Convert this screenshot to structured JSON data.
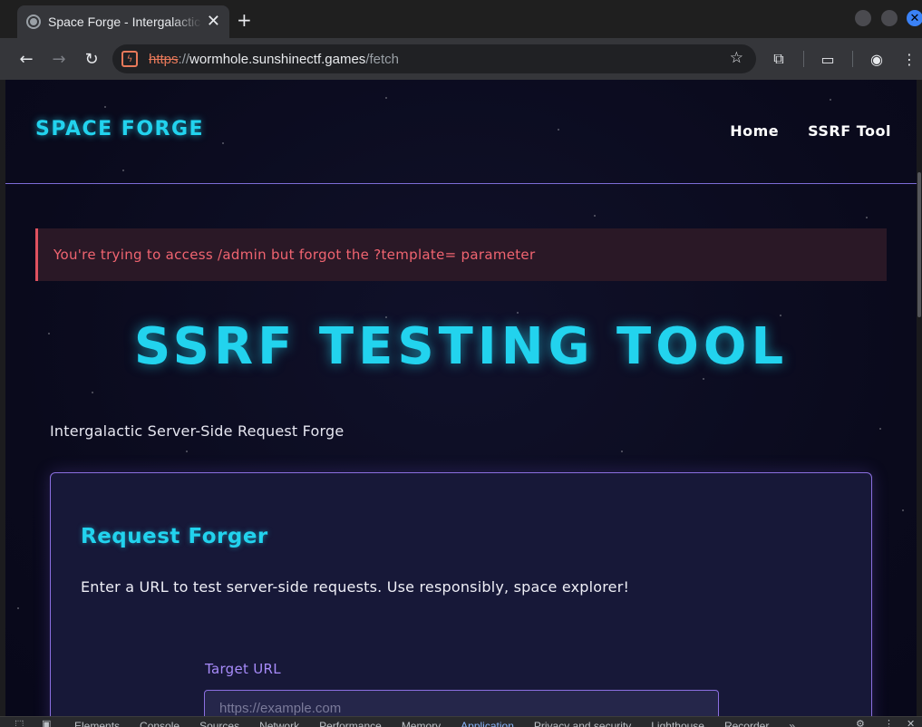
{
  "browser": {
    "tab_title": "Space Forge - Intergalactic",
    "tab_close": "✕",
    "new_tab": "+",
    "url_scheme": "https",
    "url_sep": "://",
    "url_host": "wormhole.sunshinectf.games",
    "url_path": "/fetch"
  },
  "site": {
    "logo": "SPACE FORGE",
    "nav": [
      "Home",
      "SSRF Tool"
    ]
  },
  "alert": {
    "message": "You're trying to access /admin but forgot the ?template= parameter",
    "color": "#e05260"
  },
  "hero": {
    "title": "SSRF TESTING TOOL",
    "subtitle": "Intergalactic Server-Side Request Forge"
  },
  "card": {
    "title": "Request Forger",
    "description": "Enter a URL to test server-side requests. Use responsibly, space explorer!",
    "field_label": "Target URL",
    "input_placeholder": "https://example.com",
    "input_value": ""
  },
  "devtools": {
    "tabs": [
      "Elements",
      "Console",
      "Sources",
      "Network",
      "Performance",
      "Memory",
      "Application",
      "Privacy and security",
      "Lighthouse",
      "Recorder"
    ],
    "active_tab": "Application",
    "more": "»"
  },
  "colors": {
    "accent_cyan": "#22d3ee",
    "accent_purple": "#a78bfa",
    "background": "#0a0a1c"
  }
}
